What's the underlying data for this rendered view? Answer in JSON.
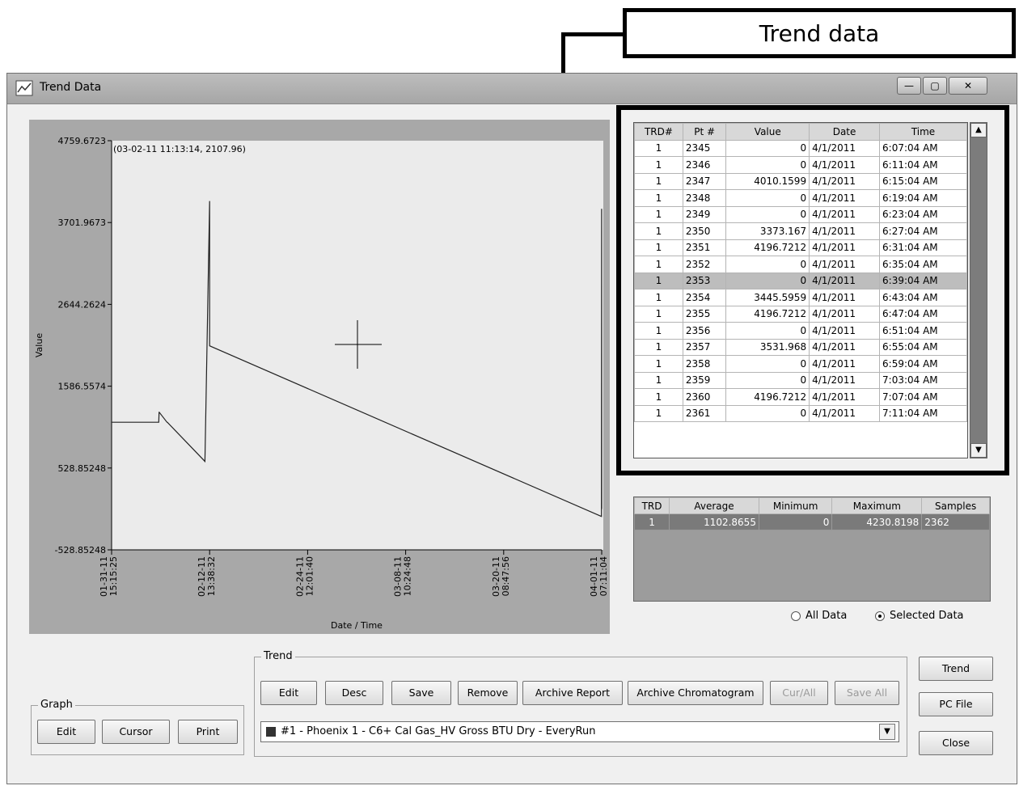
{
  "callout": {
    "label": "Trend data"
  },
  "window": {
    "title": "Trend Data"
  },
  "chart_data": {
    "type": "line",
    "xlabel": "Date / Time",
    "ylabel": "Value",
    "y_ticks": [
      "4759.6723",
      "3701.9673",
      "2644.2624",
      "1586.5574",
      "528.85248",
      "-528.85248"
    ],
    "x_ticks": [
      "01-31-11 15:15:25",
      "02-12-11 13:38:32",
      "02-24-11 12:01:40",
      "03-08-11 10:24:48",
      "03-20-11 08:47:56",
      "04-01-11 07:11:04"
    ],
    "ylim": [
      -528.85248,
      4759.6723
    ],
    "cursor_readout": "(03-02-11 11:13:14, 2107.96)",
    "series": [
      {
        "x": [
          "01-31-11 15:15",
          "02-06-11 09:00",
          "02-06-11 10:00",
          "02-06-11 10:30",
          "02-07-11 09:00",
          "02-07-11 10:00",
          "02-12-11 00:00",
          "02-12-11 13:38",
          "02-12-11 13:40",
          "02-12-11 13:42",
          "04-01-11 06:30",
          "04-01-11 07:00",
          "04-01-11 07:11"
        ],
        "y": [
          1120,
          1120,
          1250,
          1250,
          1120,
          1120,
          615,
          3980,
          2107.96,
          2107.96,
          -97,
          3880,
          0
        ]
      }
    ]
  },
  "grid": {
    "headers": [
      "TRD#",
      "Pt #",
      "Value",
      "Date",
      "Time"
    ],
    "rows": [
      [
        "1",
        "2345",
        "0",
        "4/1/2011",
        "6:07:04 AM"
      ],
      [
        "1",
        "2346",
        "0",
        "4/1/2011",
        "6:11:04 AM"
      ],
      [
        "1",
        "2347",
        "4010.1599",
        "4/1/2011",
        "6:15:04 AM"
      ],
      [
        "1",
        "2348",
        "0",
        "4/1/2011",
        "6:19:04 AM"
      ],
      [
        "1",
        "2349",
        "0",
        "4/1/2011",
        "6:23:04 AM"
      ],
      [
        "1",
        "2350",
        "3373.167",
        "4/1/2011",
        "6:27:04 AM"
      ],
      [
        "1",
        "2351",
        "4196.7212",
        "4/1/2011",
        "6:31:04 AM"
      ],
      [
        "1",
        "2352",
        "0",
        "4/1/2011",
        "6:35:04 AM"
      ],
      [
        "1",
        "2353",
        "0",
        "4/1/2011",
        "6:39:04 AM"
      ],
      [
        "1",
        "2354",
        "3445.5959",
        "4/1/2011",
        "6:43:04 AM"
      ],
      [
        "1",
        "2355",
        "4196.7212",
        "4/1/2011",
        "6:47:04 AM"
      ],
      [
        "1",
        "2356",
        "0",
        "4/1/2011",
        "6:51:04 AM"
      ],
      [
        "1",
        "2357",
        "3531.968",
        "4/1/2011",
        "6:55:04 AM"
      ],
      [
        "1",
        "2358",
        "0",
        "4/1/2011",
        "6:59:04 AM"
      ],
      [
        "1",
        "2359",
        "0",
        "4/1/2011",
        "7:03:04 AM"
      ],
      [
        "1",
        "2360",
        "4196.7212",
        "4/1/2011",
        "7:07:04 AM"
      ],
      [
        "1",
        "2361",
        "0",
        "4/1/2011",
        "7:11:04 AM"
      ]
    ],
    "selected_row": 8
  },
  "stats": {
    "headers": [
      "TRD",
      "Average",
      "Minimum",
      "Maximum",
      "Samples"
    ],
    "row": [
      "1",
      "1102.8655",
      "0",
      "4230.8198",
      "2362"
    ]
  },
  "data_scope": {
    "all_label": "All Data",
    "selected_label": "Selected Data",
    "selected": "Selected Data"
  },
  "graph_group": {
    "label": "Graph",
    "edit": "Edit",
    "cursor": "Cursor",
    "print": "Print"
  },
  "trend_group": {
    "label": "Trend",
    "edit": "Edit",
    "desc": "Desc",
    "save": "Save",
    "remove": "Remove",
    "archive_report": "Archive Report",
    "archive_chromatogram": "Archive Chromatogram",
    "cur_all": "Cur/All",
    "save_all": "Save All",
    "series_selected": "#1 - Phoenix 1 - C6+ Cal Gas_HV Gross BTU Dry - EveryRun"
  },
  "side_buttons": {
    "trend": "Trend",
    "pc_file": "PC File",
    "close": "Close"
  },
  "colors": {
    "series_swatch": "#333333",
    "scrollbar": "#7c7c7c"
  }
}
